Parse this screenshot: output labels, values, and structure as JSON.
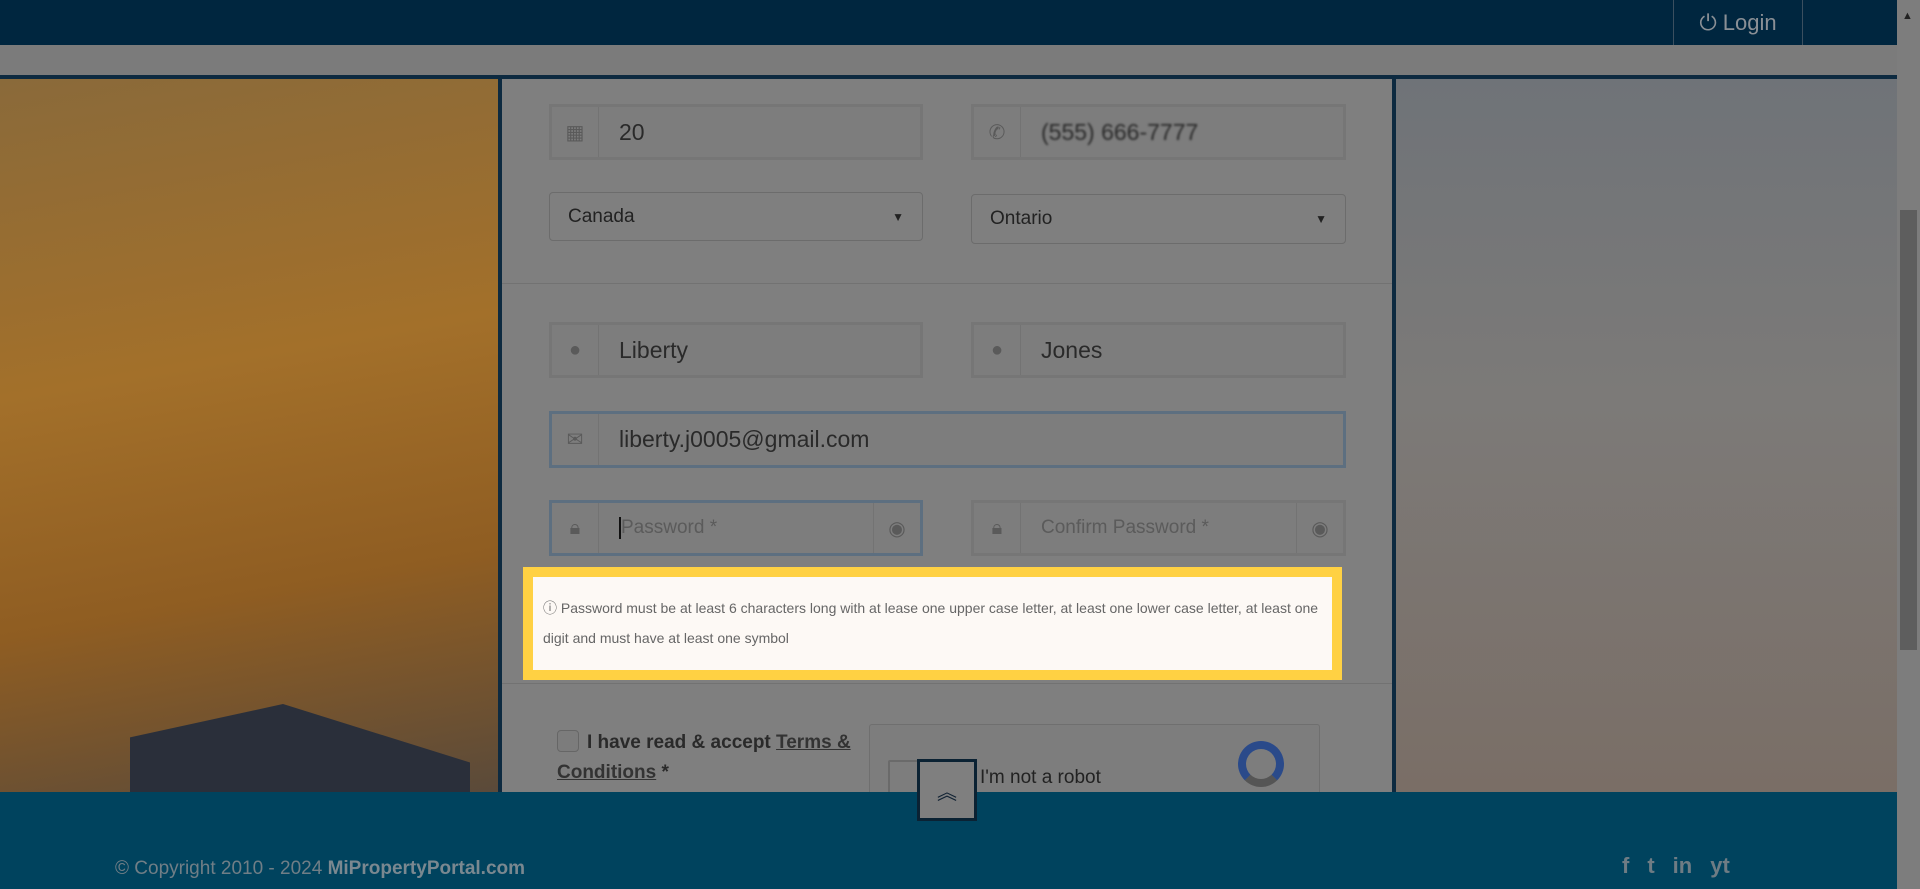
{
  "nav": {
    "login_label": "Login",
    "login_icon": "power-icon"
  },
  "form": {
    "unit": "20",
    "phone": "(555) 666-7777",
    "country": "Canada",
    "province": "Ontario",
    "first_name": "Liberty",
    "last_name": "Jones",
    "email": "liberty.j0005@gmail.com",
    "password_placeholder": "Password *",
    "confirm_placeholder": "Confirm Password *",
    "password_hint": "Password must be at least 6 characters long with at lease one upper case letter, at least one lower case letter, at least one digit and must have at least one symbol",
    "terms_prefix": "I have read & accept ",
    "terms_link": "Terms & Conditions",
    "terms_required": " *",
    "captcha_label": "I'm not a robot"
  },
  "footer": {
    "copyright_prefix": "© Copyright 2010 - 2024 ",
    "brand": "MiPropertyPortal.com",
    "social": [
      "f",
      "t",
      "in",
      "yt"
    ]
  }
}
